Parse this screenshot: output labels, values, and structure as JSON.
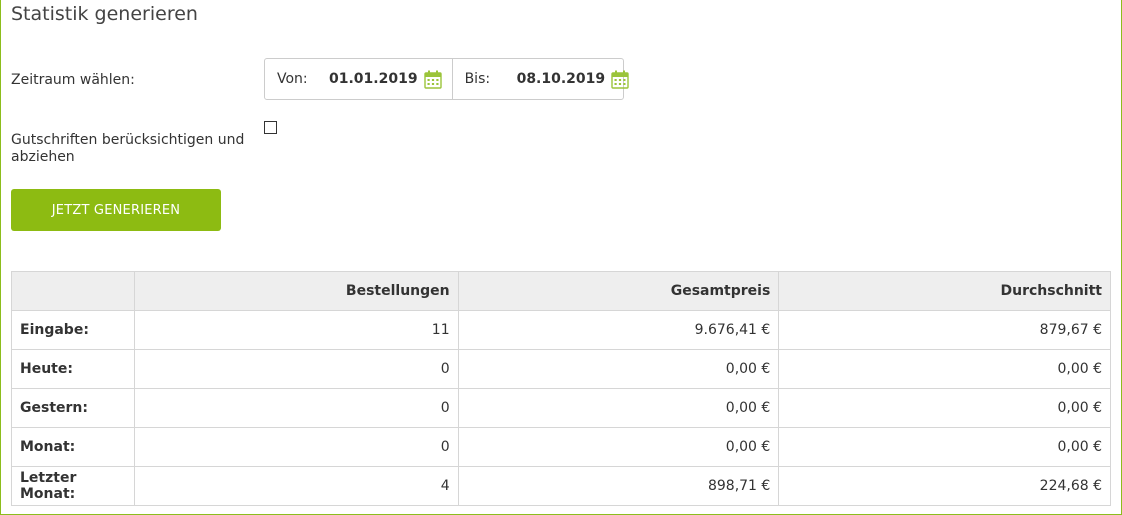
{
  "page": {
    "title": "Statistik generieren"
  },
  "form": {
    "period_label": "Zeitraum wählen:",
    "from_label": "Von:",
    "from_value": "01.01.2019",
    "to_label": "Bis:",
    "to_value": "08.10.2019",
    "credit_label": "Gutschriften berücksichtigen und abziehen",
    "credit_checked": false,
    "generate_button": "JETZT GENERIEREN"
  },
  "table": {
    "headers": [
      "",
      "Bestellungen",
      "Gesamtpreis",
      "Durchschnitt"
    ],
    "rows": [
      {
        "label": "Eingabe:",
        "orders": "11",
        "total": "9.676,41 €",
        "avg": "879,67 €"
      },
      {
        "label": "Heute:",
        "orders": "0",
        "total": "0,00 €",
        "avg": "0,00 €"
      },
      {
        "label": "Gestern:",
        "orders": "0",
        "total": "0,00 €",
        "avg": "0,00 €"
      },
      {
        "label": "Monat:",
        "orders": "0",
        "total": "0,00 €",
        "avg": "0,00 €"
      },
      {
        "label": "Letzter Monat:",
        "orders": "4",
        "total": "898,71 €",
        "avg": "224,68 €"
      }
    ]
  },
  "colors": {
    "accent": "#8dbb12",
    "frame": "#8cbd1c",
    "header_bg": "#eeeeee",
    "icon": "#9bc43a"
  },
  "icons": {
    "date_picker": "calendar-icon"
  }
}
